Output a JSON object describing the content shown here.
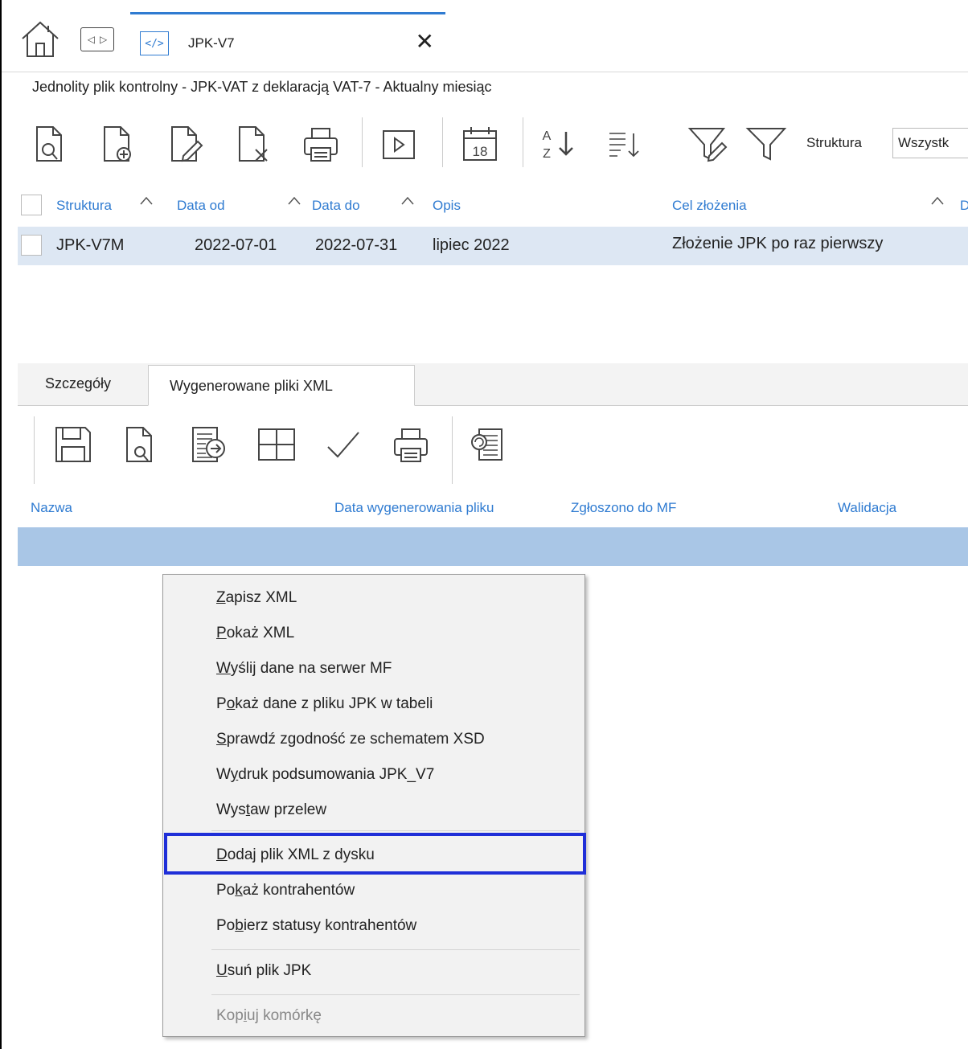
{
  "tabs": {
    "home_icon": "home-icon",
    "nav_icon": "switch-icon",
    "doc_tab_icon": "code-icon",
    "doc_tab_title": "JPK-V7",
    "close_symbol": "✕"
  },
  "window_title": "Jednolity plik kontrolny - JPK-VAT z deklaracją VAT-7 - Aktualny miesiąc",
  "toolbar": {
    "icons": [
      "view-icon",
      "add-icon",
      "edit-icon",
      "delete-icon",
      "print-icon",
      "run-icon",
      "calendar-icon",
      "sort-az-icon",
      "sort-list-icon",
      "filter-clear-icon",
      "filter-icon"
    ],
    "calendar_day": "18",
    "sort_a": "A",
    "sort_z": "Z",
    "struktura_label": "Struktura",
    "struktura_value": "Wszystk"
  },
  "grid": {
    "columns": [
      "Struktura",
      "Data od",
      "Data do",
      "Opis",
      "Cel złożenia",
      "D"
    ],
    "rows": [
      {
        "struktura": "JPK-V7M",
        "data_od": "2022-07-01",
        "data_do": "2022-07-31",
        "opis": "lipiec 2022",
        "cel": "Złożenie JPK po raz pierwszy"
      }
    ]
  },
  "lower_tabs": [
    "Szczegóły",
    "Wygenerowane pliki XML"
  ],
  "lower_toolbar": {
    "icons": [
      "save-icon",
      "preview-icon",
      "export-icon",
      "table-icon",
      "check-icon",
      "print-icon",
      "copy-doc-icon"
    ]
  },
  "xml_grid": {
    "columns": [
      "Nazwa",
      "Data wygenerowania pliku",
      "Zgłoszono do MF",
      "Walidacja"
    ]
  },
  "context_menu": {
    "items": [
      {
        "pre": "",
        "u": "Z",
        "post": "apisz XML"
      },
      {
        "pre": "",
        "u": "P",
        "post": "okaż XML"
      },
      {
        "pre": "",
        "u": "W",
        "post": "yślij dane na serwer MF"
      },
      {
        "pre": "P",
        "u": "o",
        "post": "każ dane z pliku JPK w tabeli"
      },
      {
        "pre": "",
        "u": "S",
        "post": "prawdź zgodność ze schematem XSD"
      },
      {
        "pre": "W",
        "u": "y",
        "post": "druk podsumowania JPK_V7"
      },
      {
        "pre": "Wys",
        "u": "t",
        "post": "aw przelew"
      },
      {
        "pre": "",
        "u": "D",
        "post": "odaj plik XML z dysku"
      },
      {
        "pre": "Po",
        "u": "k",
        "post": "aż kontrahentów"
      },
      {
        "pre": "Po",
        "u": "b",
        "post": "ierz statusy kontrahentów"
      },
      {
        "pre": "",
        "u": "U",
        "post": "suń plik JPK"
      },
      {
        "pre": "Kop",
        "u": "i",
        "post": "uj komórkę"
      }
    ],
    "highlight_color": "#1f2fd8"
  },
  "colors": {
    "accent": "#2f7bd1",
    "row_selected": "#dde7f3",
    "row2_selected": "#a9c6e6"
  }
}
